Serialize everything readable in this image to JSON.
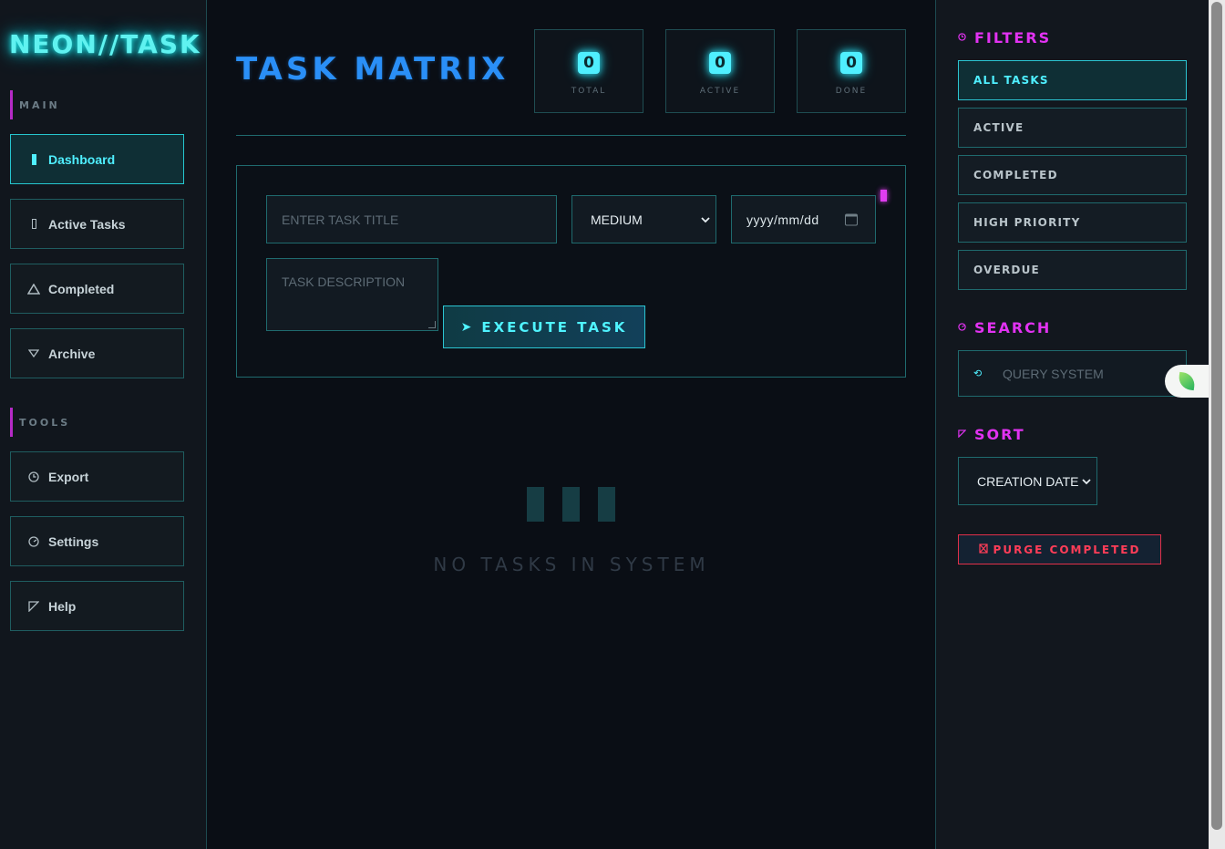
{
  "app": {
    "logo": "NEON//TASK"
  },
  "sidebar": {
    "sections": [
      {
        "label": "MAIN"
      },
      {
        "label": "TOOLS"
      }
    ],
    "items": [
      {
        "label": "Dashboard",
        "icon": "bar-icon",
        "active": true
      },
      {
        "label": "Active Tasks",
        "icon": "rectangle-icon"
      },
      {
        "label": "Completed",
        "icon": "triangle-icon"
      },
      {
        "label": "Archive",
        "icon": "triangle-down-icon"
      },
      {
        "label": "Export",
        "icon": "clock-icon"
      },
      {
        "label": "Settings",
        "icon": "gauge-icon"
      },
      {
        "label": "Help",
        "icon": "corner-triangle-icon"
      }
    ]
  },
  "main": {
    "title": "TASK MATRIX",
    "stats": [
      {
        "value": "0",
        "label": "TOTAL"
      },
      {
        "value": "0",
        "label": "ACTIVE"
      },
      {
        "value": "0",
        "label": "DONE"
      }
    ],
    "form": {
      "title_placeholder": "ENTER TASK TITLE",
      "priority_value": "MEDIUM",
      "date_placeholder": "yyyy/mm/dd",
      "description_placeholder": "TASK DESCRIPTION",
      "execute_label": "EXECUTE TASK",
      "execute_icon": "➤"
    },
    "empty_state": "NO TASKS IN SYSTEM"
  },
  "right": {
    "filters_heading": "FILTERS",
    "filters": [
      {
        "label": "ALL TASKS",
        "active": true
      },
      {
        "label": "ACTIVE"
      },
      {
        "label": "COMPLETED"
      },
      {
        "label": "HIGH PRIORITY"
      },
      {
        "label": "OVERDUE"
      }
    ],
    "search_heading": "SEARCH",
    "search_placeholder": "QUERY SYSTEM",
    "sort_heading": "SORT",
    "sort_value": "CREATION DATE",
    "purge_label": "PURGE COMPLETED"
  },
  "colors": {
    "accent_cyan": "#4fefff",
    "accent_magenta": "#e232f2",
    "title_blue": "#2a8ff7",
    "danger_red": "#ff3d58",
    "background": "#0a0e15"
  }
}
